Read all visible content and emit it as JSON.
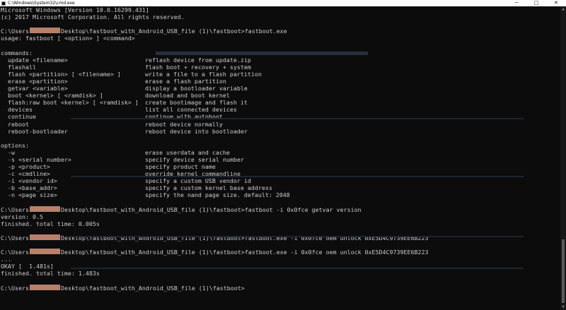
{
  "window": {
    "title": "C:\\Windows\\System32\\cmd.exe",
    "minimize_icon": "minimize-icon",
    "maximize_icon": "maximize-icon",
    "close_icon": "close-icon",
    "minimize_glyph": "─",
    "maximize_glyph": "□",
    "close_glyph": "✕"
  },
  "colors": {
    "console_bg": "#0c0c0c",
    "console_fg": "#cccccc",
    "redaction": "#b8806b"
  },
  "console": {
    "header": [
      "Microsoft Windows [Version 10.0.16299.431]",
      "(c) 2017 Microsoft Corporation. All rights reserved."
    ],
    "prompt1": {
      "user": "C:\\Users",
      "path": "Desktop\\fastboot_with_Android_USB_file (1)\\fastboot>",
      "cmd": "fastboot.exe"
    },
    "usage": "usage: fastboot [ <option> ] <command>",
    "commands_heading": "commands:",
    "commands": [
      {
        "name": "  update <filename>",
        "desc": "reflash device from update.zip"
      },
      {
        "name": "  flashall",
        "desc": "flash boot + recovery + system"
      },
      {
        "name": "  flash <partition> [ <filename> ]",
        "desc": "write a file to a flash partition"
      },
      {
        "name": "  erase <partition>",
        "desc": "erase a flash partition"
      },
      {
        "name": "  getvar <variable>",
        "desc": "display a bootloader variable"
      },
      {
        "name": "  boot <kernel> [ <ramdisk> ]",
        "desc": "download and boot kernel"
      },
      {
        "name": "  flash:raw boot <kernel> [ <ramdisk> ]",
        "desc": "create bootimage and flash it"
      },
      {
        "name": "  devices",
        "desc": "list all connected devices"
      },
      {
        "name": "  continue",
        "desc": "continue with autoboot"
      },
      {
        "name": "  reboot",
        "desc": "reboot device normally"
      },
      {
        "name": "  reboot-bootloader",
        "desc": "reboot device into bootloader"
      }
    ],
    "options_heading": "options:",
    "options": [
      {
        "name": "  -w",
        "desc": "erase userdata and cache"
      },
      {
        "name": "  -s <serial number>",
        "desc": "specify device serial number"
      },
      {
        "name": "  -p <product>",
        "desc": "specify product name"
      },
      {
        "name": "  -c <cmdline>",
        "desc": "override kernel commandline"
      },
      {
        "name": "  -i <vendor id>",
        "desc": "specify a custom USB vendor id"
      },
      {
        "name": "  -b <base_addr>",
        "desc": "specify a custom kernel base address"
      },
      {
        "name": "  -n <page size>",
        "desc": "specify the nand page size. default: 2048"
      }
    ],
    "prompt2": {
      "user": "C:\\Users",
      "path": "Desktop\\fastboot_with_Android_USB_file (1)\\fastboot>",
      "cmd": "fastboot -i 0x0fce getvar version"
    },
    "out2": [
      "version: 0.5",
      "finished. total time: 0.005s"
    ],
    "prompt3": {
      "user": "C:\\Users",
      "path": "Desktop\\fastboot_with_Android_USB_file (1)\\fastboot>",
      "cmd": "fastboot.exe -i 0x0fce oem unlock 0xE5D4C9739EE6B223"
    },
    "prompt4": {
      "user": "C:\\Users",
      "path": "Desktop\\fastboot_with_Android_USB_file (1)\\fastboot>",
      "cmd": "fastboot.exe -i 0x0fce oem unlock 0xE5D4C9739EE6B223"
    },
    "out4": [
      "...",
      "OKAY [  1.481s]",
      "finished. total time: 1.483s"
    ],
    "prompt5": {
      "user": "C:\\Users",
      "path": "Desktop\\fastboot_with_Android_USB_file (1)\\fastboot>",
      "cmd": ""
    }
  },
  "scrollbar": {
    "up_icon": "scroll-up-icon",
    "down_icon": "scroll-down-icon",
    "up_glyph": "▲",
    "down_glyph": "▼"
  }
}
